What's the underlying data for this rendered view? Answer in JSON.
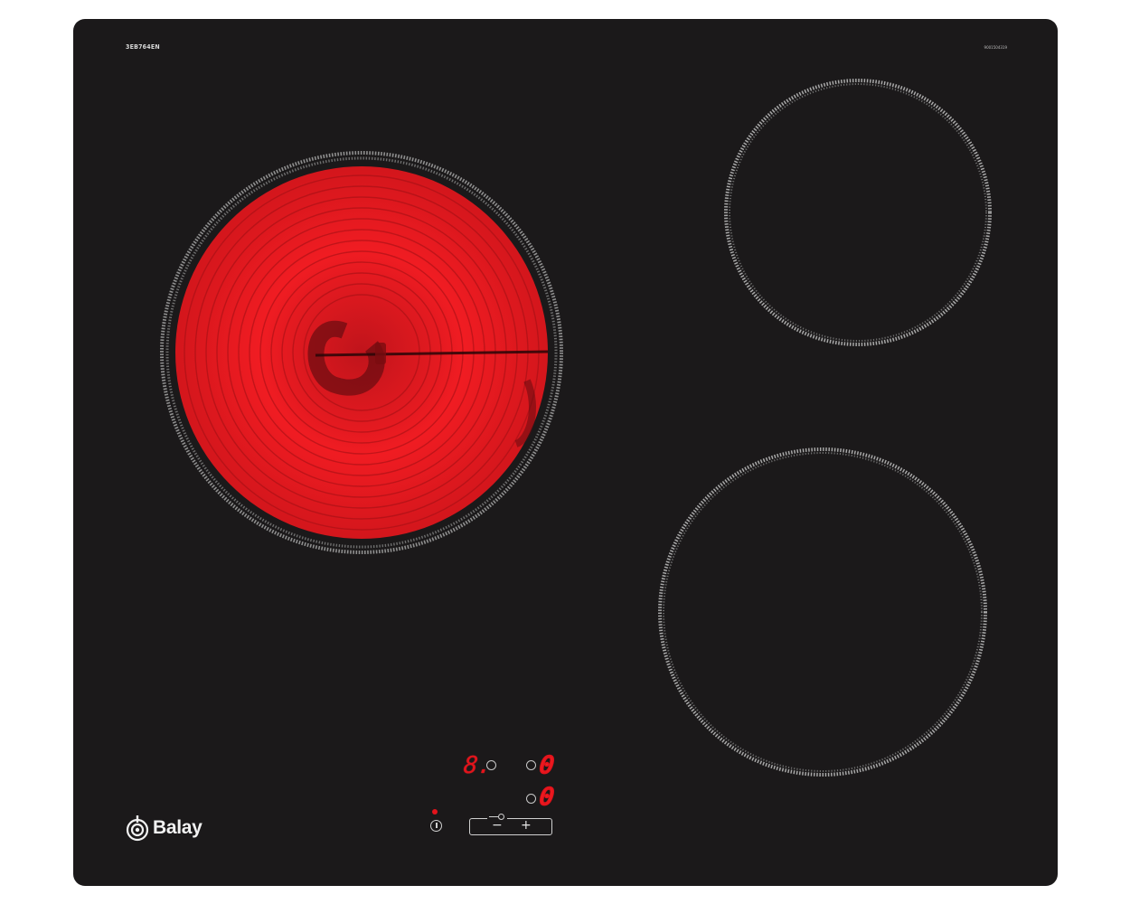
{
  "hob": {
    "model": "3EB764EN",
    "serial": "9001504319",
    "brand": "Balay",
    "colors": {
      "glass": "#1b191a",
      "heating": "#e3131b",
      "markings": "#cfcfcf"
    }
  },
  "zones": [
    {
      "id": "front-left",
      "state": "heating"
    },
    {
      "id": "rear-right",
      "state": "off"
    },
    {
      "id": "front-right",
      "state": "off"
    }
  ],
  "controls": {
    "display_left": "8.",
    "display_right_top": "0",
    "display_right_bottom": "0",
    "power_icon": "power-icon",
    "lock_icon": "key-lock-icon",
    "minus_label": "−",
    "plus_label": "+",
    "power_led": "on"
  }
}
